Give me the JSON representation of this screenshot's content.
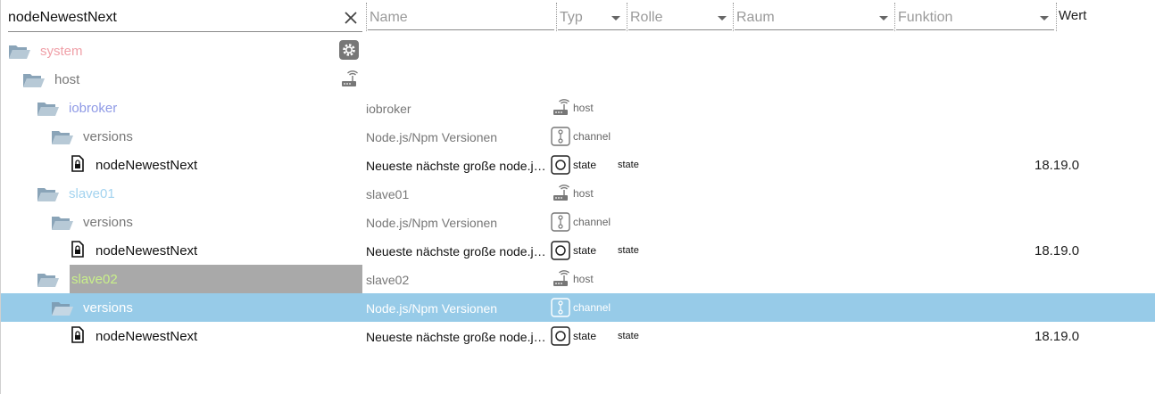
{
  "search": {
    "value": "nodeNewestNext",
    "placeholder": ""
  },
  "filters": {
    "name": "Name",
    "typ": "Typ",
    "rolle": "Rolle",
    "raum": "Raum",
    "funktion": "Funktion",
    "wert": "Wert"
  },
  "colors": {
    "system": "#f0a0a8",
    "iobroker": "#8f9ae6",
    "slave01": "#a3d3ef",
    "slave02": "#c9f08a",
    "selected_row": "#97cbe8",
    "slave02_highlight": "#a9a9a9"
  },
  "tree": [
    {
      "name": "system",
      "icon": "gear-icon"
    },
    {
      "name": "host",
      "icon": "host-icon"
    },
    {
      "name": "iobroker",
      "desc": "iobroker",
      "type": "host"
    },
    {
      "name": "versions",
      "desc": "Node.js/Npm Versionen",
      "type": "channel"
    },
    {
      "name": "nodeNewestNext",
      "desc": "Neueste nächste große node.js ...",
      "type": "state",
      "role": "state",
      "value": "18.19.0"
    },
    {
      "name": "slave01",
      "desc": "slave01",
      "type": "host"
    },
    {
      "name": "versions",
      "desc": "Node.js/Npm Versionen",
      "type": "channel"
    },
    {
      "name": "nodeNewestNext",
      "desc": "Neueste nächste große node.js ...",
      "type": "state",
      "role": "state",
      "value": "18.19.0"
    },
    {
      "name": "slave02",
      "desc": "slave02",
      "type": "host"
    },
    {
      "name": "versions",
      "desc": "Node.js/Npm Versionen",
      "type": "channel"
    },
    {
      "name": "nodeNewestNext",
      "desc": "Neueste nächste große node.js ...",
      "type": "state",
      "role": "state",
      "value": "18.19.0"
    }
  ]
}
